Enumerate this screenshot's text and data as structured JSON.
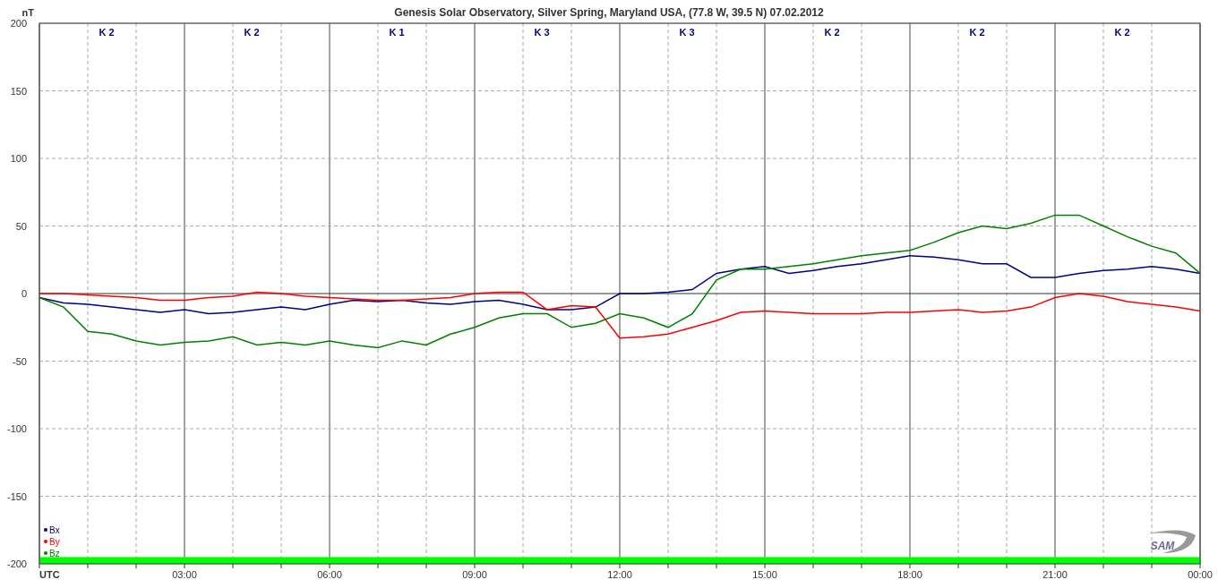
{
  "chart": {
    "chart_data": {
      "type": "line",
      "title": "Genesis Solar Observatory, Silver Spring, Maryland USA, (77.8 W, 39.5 N)  07.02.2012",
      "ylabel": "nT",
      "grid": true,
      "x": [
        0,
        0.5,
        1,
        1.5,
        2,
        2.5,
        3,
        3.5,
        4,
        4.5,
        5,
        5.5,
        6,
        6.5,
        7,
        7.5,
        8,
        8.5,
        9,
        9.5,
        10,
        10.5,
        11,
        11.5,
        12,
        12.5,
        13,
        13.5,
        14,
        14.5,
        15,
        15.5,
        16,
        16.5,
        17,
        17.5,
        18,
        18.5,
        19,
        19.5,
        20,
        20.5,
        21,
        21.5,
        22,
        22.5,
        23,
        23.5,
        24
      ],
      "series": [
        {
          "name": "Bx",
          "color": "#000080",
          "values": [
            -3,
            -7,
            -8,
            -10,
            -12,
            -14,
            -12,
            -15,
            -14,
            -12,
            -10,
            -12,
            -8,
            -5,
            -6,
            -5,
            -7,
            -8,
            -6,
            -5,
            -8,
            -12,
            -12,
            -10,
            0,
            0,
            1,
            3,
            15,
            18,
            20,
            15,
            17,
            20,
            22,
            25,
            28,
            27,
            25,
            22,
            22,
            12,
            12,
            15,
            17,
            18,
            20,
            18,
            15
          ]
        },
        {
          "name": "By",
          "color": "#ff0000",
          "values": [
            0,
            0,
            -1,
            -2,
            -3,
            -5,
            -5,
            -3,
            -2,
            1,
            0,
            -2,
            -3,
            -4,
            -5,
            -5,
            -4,
            -3,
            0,
            1,
            1,
            -12,
            -9,
            -10,
            -33,
            -32,
            -30,
            -25,
            -20,
            -14,
            -13,
            -14,
            -15,
            -15,
            -15,
            -14,
            -14,
            -13,
            -12,
            -14,
            -13,
            -10,
            -3,
            0,
            -2,
            -6,
            -8,
            -10,
            -13
          ]
        },
        {
          "name": "Bz",
          "color": "#008000",
          "values": [
            -3,
            -10,
            -28,
            -30,
            -35,
            -38,
            -36,
            -35,
            -32,
            -38,
            -36,
            -38,
            -35,
            -38,
            -40,
            -35,
            -38,
            -30,
            -25,
            -18,
            -15,
            -15,
            -25,
            -22,
            -15,
            -18,
            -25,
            -15,
            10,
            18,
            18,
            20,
            22,
            25,
            28,
            30,
            32,
            38,
            45,
            50,
            48,
            52,
            58,
            58,
            50,
            42,
            35,
            30,
            15
          ]
        }
      ],
      "xlim": [
        0,
        24
      ],
      "ylim": [
        -200,
        200
      ],
      "xticks": [
        {
          "value": 0,
          "label": "UTC"
        },
        {
          "value": 3,
          "label": "03:00"
        },
        {
          "value": 6,
          "label": "06:00"
        },
        {
          "value": 9,
          "label": "09:00"
        },
        {
          "value": 12,
          "label": "12:00"
        },
        {
          "value": 15,
          "label": "15:00"
        },
        {
          "value": 18,
          "label": "18:00"
        },
        {
          "value": 21,
          "label": "21:00"
        },
        {
          "value": 24,
          "label": "00:00"
        }
      ],
      "yticks": [
        -200,
        -150,
        -100,
        -50,
        0,
        50,
        100,
        150,
        200
      ],
      "bands": [
        {
          "axis": "y",
          "from": -200,
          "to": -195,
          "color": "#00ff00"
        }
      ]
    },
    "k_indices": [
      "K 2",
      "K 2",
      "K 1",
      "K 3",
      "K 3",
      "K 2",
      "K 2",
      "K 2"
    ],
    "logo": "SAM"
  }
}
